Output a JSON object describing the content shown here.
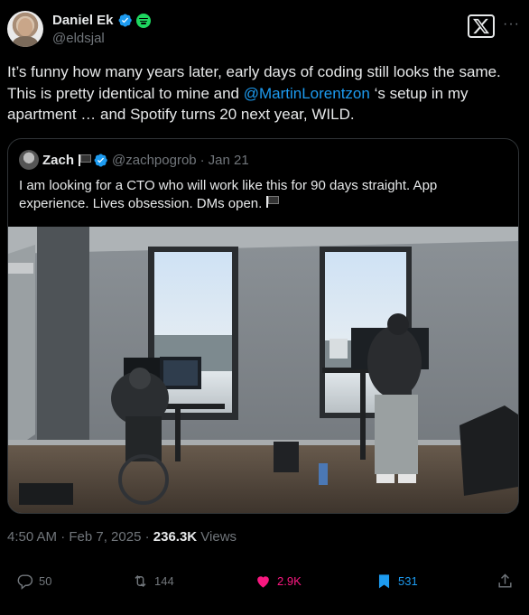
{
  "author": {
    "name": "Daniel Ek",
    "handle": "@eldsjal"
  },
  "brand_logo": "x-logo",
  "more_label": "···",
  "tweet": {
    "text_before": "It’s funny how many years later, early days of coding still looks the same. This is pretty identical to mine and ",
    "mention": "@MartinLorentzon",
    "text_after": " ‘s setup in my apartment … and Spotify turns 20 next year, WILD."
  },
  "quote": {
    "name": "Zach",
    "handle": "@zachpogrob",
    "separator": "·",
    "date": "Jan 21",
    "text": "I am looking for a CTO who will work like this for 90 days straight. App experience. Lives obsession. DMs open."
  },
  "meta": {
    "time": "4:50 AM · Feb 7, 2025 · ",
    "views_count": "236.3K",
    "views_label": " Views"
  },
  "actions": {
    "replies": "50",
    "reposts": "144",
    "likes": "2.9K",
    "bookmarks": "531"
  },
  "colors": {
    "accent": "#1d9bf0",
    "like": "#f91880",
    "muted": "#71767b",
    "spotify": "#1ed760"
  }
}
